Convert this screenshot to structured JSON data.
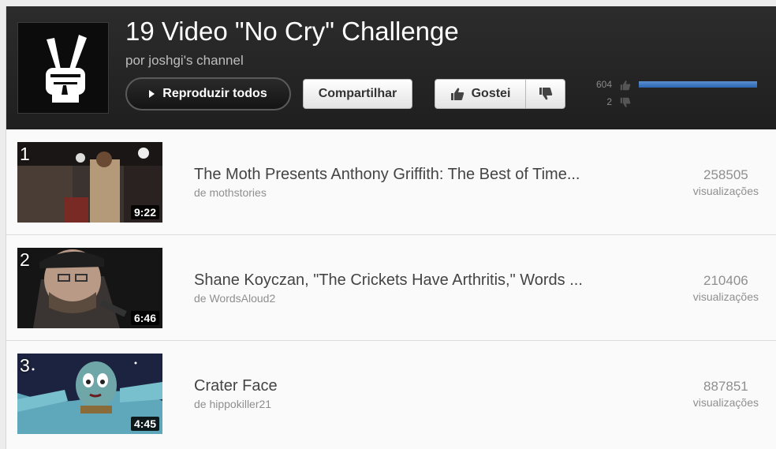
{
  "playlist": {
    "title": "19 Video \"No Cry\" Challenge",
    "byline": "por joshgi's channel",
    "logo_icon": "peace-hand-icon"
  },
  "actions": {
    "play_all_label": "Reproduzir todos",
    "share_label": "Compartilhar",
    "like_label": "Gostei"
  },
  "stats": {
    "likes": "604",
    "dislikes": "2",
    "like_ratio": 0.997,
    "bar_color": "#2c66b0"
  },
  "videos": [
    {
      "index": "1",
      "duration": "9:22",
      "title": "The Moth Presents Anthony Griffith: The Best of Time...",
      "channel": "de mothstories",
      "views": "258505",
      "views_label": "visualizações"
    },
    {
      "index": "2",
      "duration": "6:46",
      "title": "Shane Koyczan, \"The Crickets Have Arthritis,\" Words ...",
      "channel": "de WordsAloud2",
      "views": "210406",
      "views_label": "visualizações"
    },
    {
      "index": "3",
      "duration": "4:45",
      "title": "Crater Face",
      "channel": "de hippokiller21",
      "views": "887851",
      "views_label": "visualizações"
    }
  ]
}
